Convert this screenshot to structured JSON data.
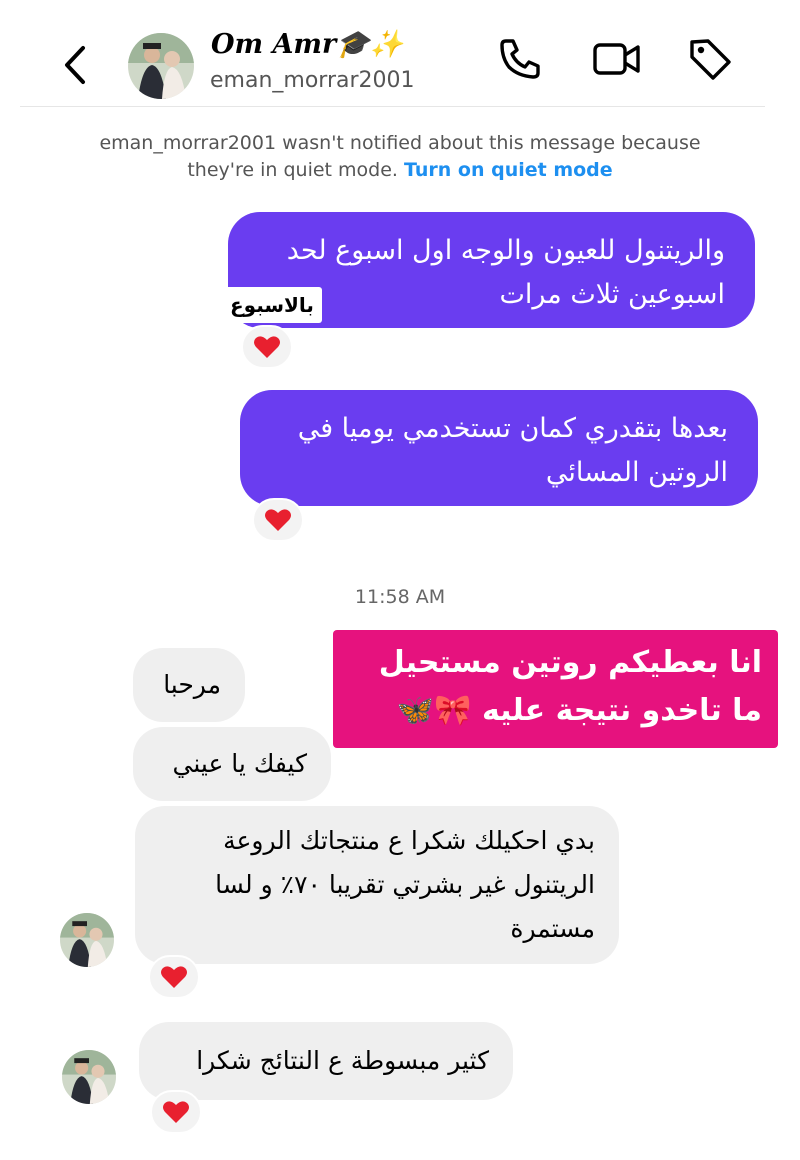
{
  "header": {
    "name": "Om Amr🎓✨",
    "username": "eman_morrar2001"
  },
  "notice": {
    "text": "eman_morrar2001 wasn't notified about this message because they're in quiet mode.",
    "link": "Turn on quiet mode"
  },
  "messages": {
    "sent1": {
      "lines": [
        "والريتنول للعيون والوجه اول اسبوع لحد",
        "اسبوعين ثلاث مرات"
      ],
      "overlay": "بالاسبوع"
    },
    "sent2": {
      "lines": [
        "بعدها بتقدري كمان تستخدمي يوميا في",
        "الروتين المسائي"
      ]
    },
    "timestamp": "11:58 AM",
    "sticker": {
      "lines": [
        "انا بعطيكم روتين مستحيل",
        "ما تاخدو نتيجة عليه 🎀🦋"
      ]
    },
    "recv1": "مرحبا",
    "recv2": "كيفك يا عيني",
    "recv3": {
      "lines": [
        "بدي احكيلك شكرا ع منتجاتك الروعة",
        "الريتنول غير بشرتي تقريبا ٧٠٪ و لسا",
        "مستمرة"
      ]
    },
    "recv4": "كثير مبسوطة ع النتائج شكرا"
  },
  "reaction": "❤️",
  "colors": {
    "sent_bubble": "#6a3df0",
    "received_bubble": "#efefef",
    "sticker": "#e6127e",
    "link": "#1d8ff0",
    "heart": "#e8202f"
  },
  "icons": [
    "back-chevron-icon",
    "phone-icon",
    "video-camera-icon",
    "tag-icon",
    "heart-icon"
  ]
}
